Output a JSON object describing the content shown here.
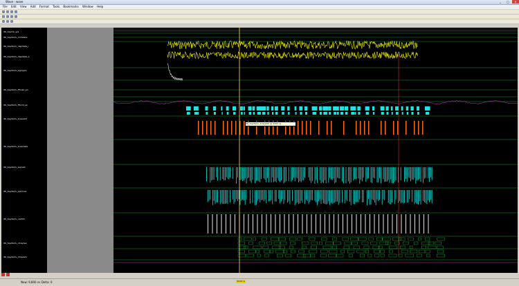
{
  "window": {
    "title": "Wave - wave"
  },
  "menu": [
    "File",
    "Edit",
    "View",
    "Add",
    "Format",
    "Tools",
    "Bookmarks",
    "Window",
    "Help"
  ],
  "signals": [
    "/tb_top/clk_sys",
    "/tb_top/dut/u_ctrl/state",
    "/tb_top/dut/u_dsp/data_i",
    "/tb_top/dut/u_dsp/data_q",
    "/tb_top/dut/u_agc/gain",
    "/tb_top/dut/u_fifo/wr_en",
    "/tb_top/dut/u_fifo/rd_en",
    "/tb_top/dut/u_bus/addr",
    "/tb_top/dut/u_bus/rdata",
    "/tb_top/dut/u_spi/sclk",
    "/tb_top/dut/u_spi/mosi",
    "/tb_top/dut/u_uart/tx",
    "/tb_top/dut/u_dma/req",
    "/tb_top/dut/u_dma/ack"
  ],
  "tooltip": "/tb_top/dut/u_bus/addr @ 3104 ns",
  "status": {
    "text": "Now: 9,800 ns  Delta: 0",
    "cursor": "3104 ns"
  },
  "colors": {
    "wave_bg": "#000000",
    "yellow": "#f0f000",
    "cyan": "#19e5e5",
    "green": "#25c43a",
    "orange": "#ff6a1a",
    "magenta": "#cc33cc",
    "white": "#e8e8e8",
    "cursor": "#ffe34d"
  }
}
